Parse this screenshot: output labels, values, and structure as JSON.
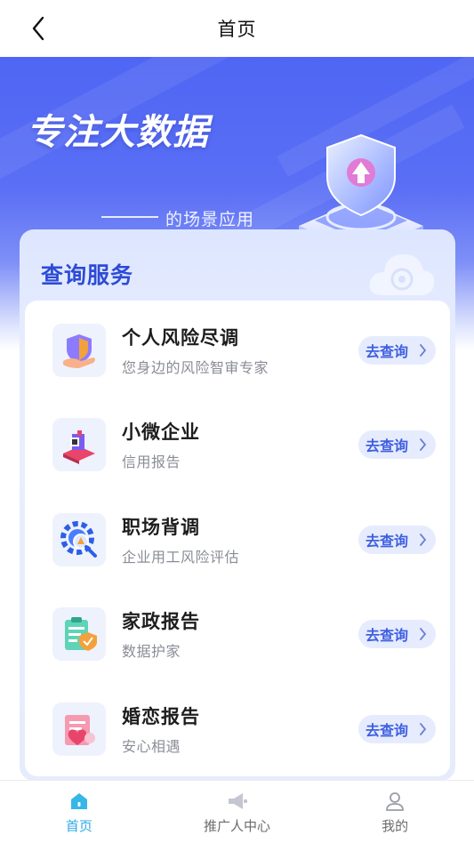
{
  "nav": {
    "title": "首页"
  },
  "hero": {
    "headline": "专注大数据",
    "subtitle": "的场景应用"
  },
  "services": {
    "title": "查询服务",
    "button_label": "去查询",
    "items": [
      {
        "name": "个人风险尽调",
        "desc": "您身边的风险智审专家",
        "icon": "shield-hand-icon"
      },
      {
        "name": "小微企业",
        "desc": "信用报告",
        "icon": "enterprise-icon"
      },
      {
        "name": "职场背调",
        "desc": "企业用工风险评估",
        "icon": "gear-search-icon"
      },
      {
        "name": "家政报告",
        "desc": "数据护家",
        "icon": "clipboard-shield-icon"
      },
      {
        "name": "婚恋报告",
        "desc": "安心相遇",
        "icon": "heart-document-icon"
      }
    ]
  },
  "tabbar": {
    "items": [
      {
        "label": "首页",
        "icon": "home-icon",
        "active": true
      },
      {
        "label": "推广人中心",
        "icon": "megaphone-icon",
        "active": false
      },
      {
        "label": "我的",
        "icon": "user-icon",
        "active": false
      }
    ]
  },
  "colors": {
    "accent": "#4f66f4",
    "title_blue": "#2d4bd6",
    "active_tab": "#2fa8e7"
  }
}
